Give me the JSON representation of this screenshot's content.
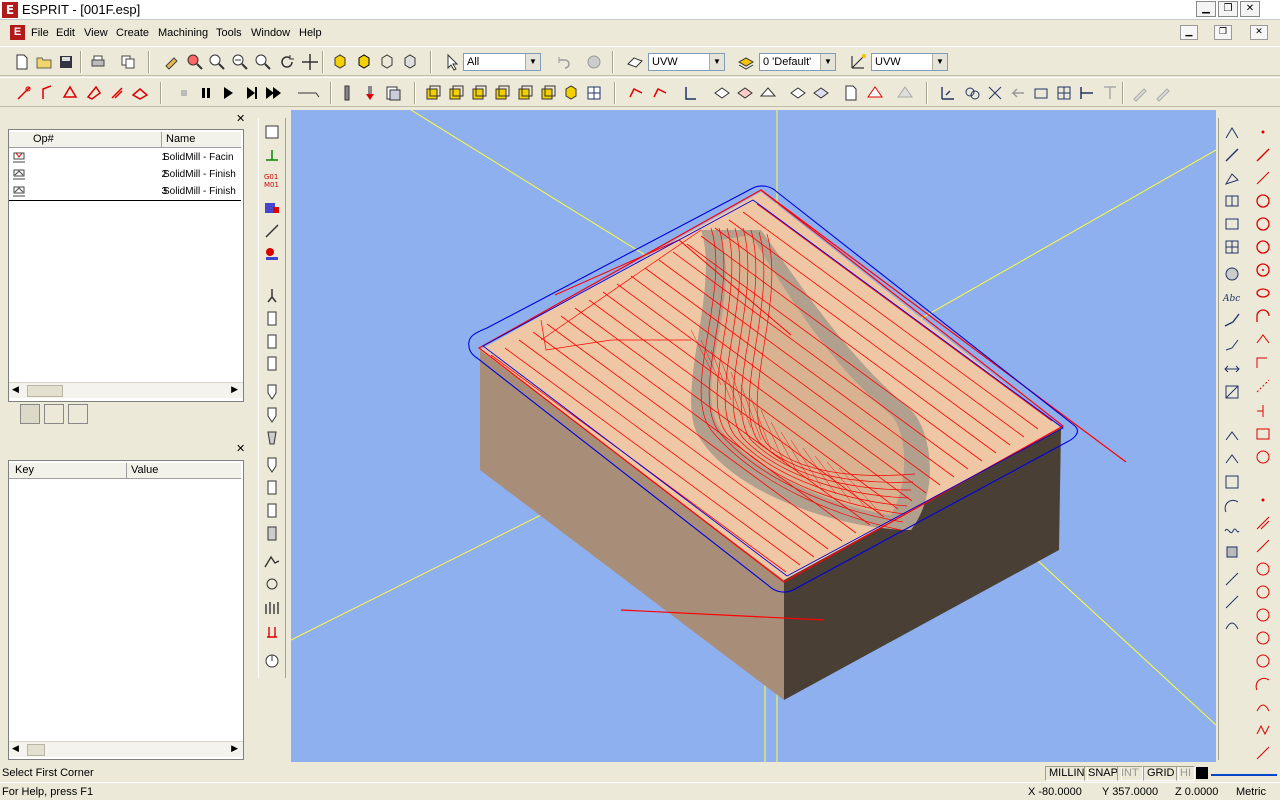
{
  "window": {
    "title": "ESPRIT - [001F.esp]",
    "logo_letter": "E"
  },
  "menu": [
    "File",
    "Edit",
    "View",
    "Create",
    "Machining",
    "Tools",
    "Window",
    "Help"
  ],
  "toolbar": {
    "filter_value": "All",
    "workplane_value": "UVW",
    "layer_value": "0 'Default'",
    "view_value": "UVW"
  },
  "operations_panel": {
    "columns": [
      "Op#",
      "Name"
    ],
    "rows": [
      {
        "num": "1",
        "name": "SolidMill - Facin"
      },
      {
        "num": "2",
        "name": "SolidMill - Finish"
      },
      {
        "num": "3",
        "name": "SolidMill - Finish"
      }
    ]
  },
  "properties_panel": {
    "columns": [
      "Key",
      "Value"
    ]
  },
  "status": {
    "prompt": "Select First Corner",
    "help": "For Help, press F1",
    "indicators": [
      "MILLIN",
      "SNAP",
      "INT",
      "GRID",
      "HI"
    ],
    "x": "X -80.0000",
    "y": "Y 357.0000",
    "z": "Z 0.0000",
    "units": "Metric"
  },
  "colors": {
    "viewport_bg": "#8fb0ef",
    "stock_top": "#f0c7a4",
    "stock_front": "#a88e78",
    "stock_side": "#4a3f35",
    "toolpath": "#ff0000",
    "boundary": "#0000dd",
    "axis": "#ffff33"
  }
}
